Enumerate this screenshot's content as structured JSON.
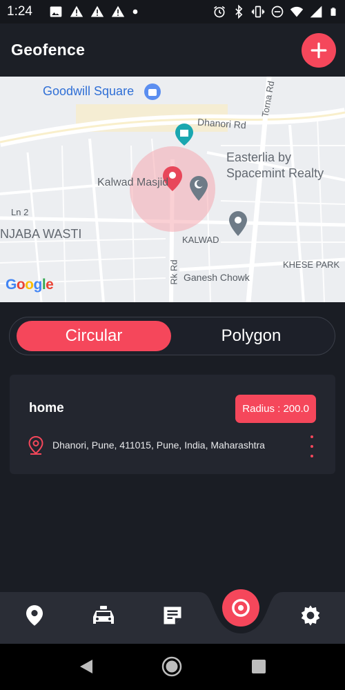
{
  "status_bar": {
    "time": "1:24",
    "left_icons": [
      "image-icon",
      "alert-icon",
      "alert-icon",
      "alert-icon",
      "dot-icon"
    ],
    "right_icons": [
      "alarm-icon",
      "bluetooth-icon",
      "vibrate-icon",
      "do-not-disturb-icon",
      "wifi-icon",
      "signal-icon",
      "battery-icon"
    ]
  },
  "header": {
    "title": "Geofence",
    "add_icon": "plus-icon"
  },
  "map": {
    "labels": {
      "goodwill": "Goodwill Square",
      "dhanori_rd": "Dhanori Rd",
      "torna_rd": "Torna Rd",
      "easterlia_1": "Easterlia by",
      "easterlia_2": "Spacemint Realty",
      "kalwad_masjid": "Kalwad Masjid",
      "ln2": "Ln 2",
      "njaba": "NJABA WASTI",
      "kalwad": "KALWAD",
      "rk_rd": "Rk Rd",
      "khese": "KHESE PARK",
      "ganesh": "Ganesh Chowk"
    },
    "logo": "Google",
    "colors": {
      "geofence_fill": "#f5a9b0",
      "marker": "#e8475a"
    }
  },
  "tabs": {
    "active": "Circular",
    "inactive": "Polygon"
  },
  "geofence_item": {
    "name": "home",
    "radius_label": "Radius : 200.0",
    "address": "Dhanori, Pune, 411015, Pune, India, Maharashtra",
    "location_icon": "location-pin-icon",
    "more_icon": "more-vertical-icon"
  },
  "bottom_nav": {
    "items": [
      "location-icon",
      "car-icon",
      "notes-icon",
      "geofence-target-icon",
      "settings-icon"
    ],
    "active": "geofence-target-icon"
  },
  "system_nav": [
    "back-icon",
    "home-icon",
    "recents-icon"
  ],
  "colors": {
    "accent": "#f5475b",
    "background": "#1a1d24",
    "card": "#23262f",
    "header": "#1c1f26"
  }
}
